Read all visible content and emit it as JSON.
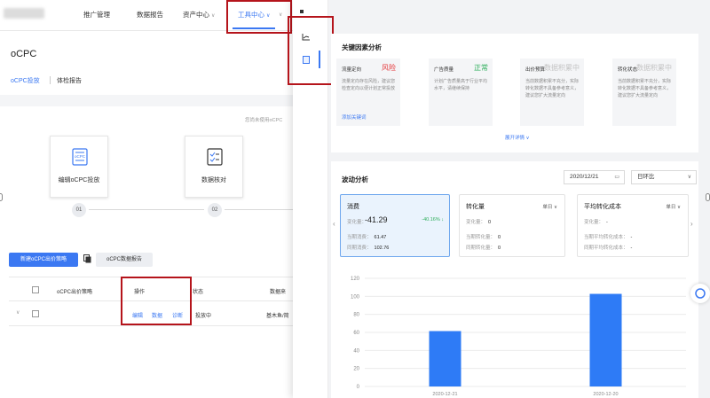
{
  "topnav": {
    "items": [
      "推广管理",
      "数据报告",
      "资产中心",
      "工具中心"
    ],
    "dropdown_arrow": "∨"
  },
  "page": {
    "title": "oCPC",
    "tabs": [
      "oCPC投放",
      "体检报告"
    ],
    "hint": "您尚未使用oCPC"
  },
  "steps": {
    "card_icon_text": "oCPC",
    "labels": [
      "编辑oCPC投放",
      "数据核对"
    ],
    "numbers": [
      "01",
      "02"
    ]
  },
  "actions": {
    "new_button": "新建oCPC出价策略",
    "report_button": "oCPC数据报告"
  },
  "table": {
    "headers": [
      "oCPC出价策略",
      "操作",
      "状态",
      "数据来"
    ],
    "row": {
      "ops": [
        "编辑",
        "数据",
        "诊断"
      ],
      "status": "投放中",
      "data_source": "基木鱼/简"
    }
  },
  "drawer": {
    "key_factors": {
      "title": "关键因素分析",
      "cards": [
        {
          "name": "流量定向",
          "status": "风险",
          "status_color": "#e5383b",
          "desc": "流量定向存在风险，建议您检查定向以便计划正常投放",
          "link": "添加关键词"
        },
        {
          "name": "广告质量",
          "status": "正常",
          "status_color": "#2eae5b",
          "desc": "计划广告质量高于行业平均水平，请继续保持",
          "link": ""
        },
        {
          "name": "出价预算",
          "status": "数据积累中",
          "status_color": "#c4c4c4",
          "desc": "当前数据积累不充分，实际转化数据不具备参考意义，建议您扩大流量定向",
          "link": ""
        },
        {
          "name": "转化状态",
          "status": "数据积累中",
          "status_color": "#c4c4c4",
          "desc": "当前数据积累不充分，实际转化数据不具备参考意义，建议您扩大流量定向",
          "link": ""
        }
      ],
      "expand": "展开详情"
    },
    "fluctuation": {
      "title": "波动分析",
      "date": "2020/12/21",
      "compare": "日环比",
      "metrics": [
        {
          "name": "消费",
          "unit": "",
          "change_label": "变化量：",
          "change": "-41.29",
          "pct": "-40.16% ↓",
          "cur_label": "当期消费：",
          "cur": "61.47",
          "prev_label": "同期消费：",
          "prev": "102.76",
          "selected": true
        },
        {
          "name": "转化量",
          "unit": "单日",
          "change_label": "变化量：",
          "change": "0",
          "pct": "",
          "cur_label": "当期转化量：",
          "cur": "0",
          "prev_label": "同期转化量：",
          "prev": "0",
          "selected": false
        },
        {
          "name": "平均转化成本",
          "unit": "单日",
          "change_label": "变化量：",
          "change": "-",
          "pct": "",
          "cur_label": "当期平均转化成本：",
          "cur": "-",
          "prev_label": "同期平均转化成本：",
          "prev": "-",
          "selected": false
        }
      ]
    }
  },
  "chart_data": {
    "type": "bar",
    "categories": [
      "2020-12-21",
      "2020-12-20"
    ],
    "values": [
      61.47,
      102.76
    ],
    "ylim": [
      0,
      120
    ],
    "yticks": [
      0,
      20,
      40,
      60,
      80,
      100,
      120
    ],
    "bar_color": "#2e7bf6",
    "grid": true
  }
}
